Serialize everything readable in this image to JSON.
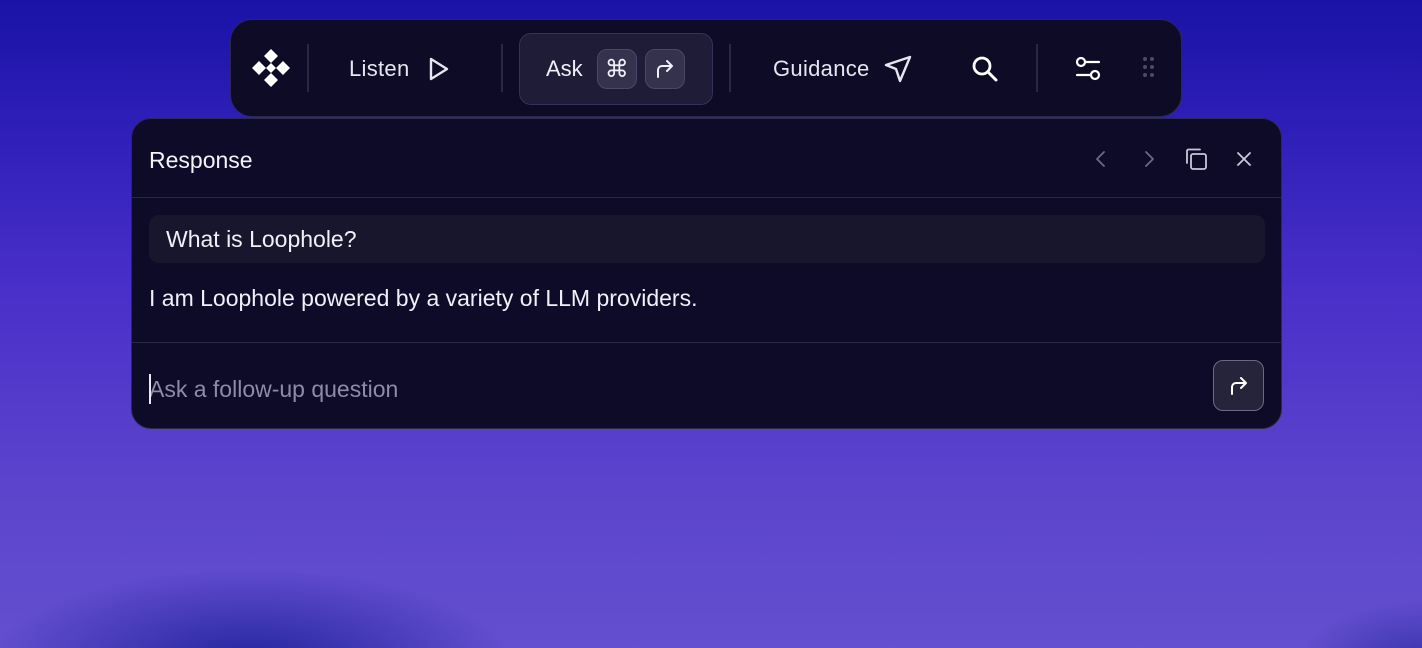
{
  "toolbar": {
    "logo_icon": "diamond-cluster-logo",
    "listen_label": "Listen",
    "listen_icon": "play-icon",
    "ask_label": "Ask",
    "ask_shortcut_keys": [
      "⌘",
      "↵"
    ],
    "guidance_label": "Guidance",
    "guidance_icon": "cursor-arrow-icon",
    "search_icon": "search-icon",
    "settings_icon": "sliders-icon",
    "drag_icon": "grip-icon"
  },
  "panel": {
    "title": "Response",
    "header_icons": [
      "chevron-left-icon",
      "chevron-right-icon",
      "copy-icon",
      "close-icon"
    ],
    "question": "What is Loophole?",
    "answer": "I am Loophole powered by a variety of LLM providers.",
    "followup_placeholder": "Ask a follow-up question",
    "followup_value": "",
    "send_icon": "send-arrow-icon"
  },
  "colors": {
    "background_top": "#1a12a6",
    "background_bottom": "#634fcf",
    "panel_bg": "#0e0b28",
    "text": "#f0f0f8"
  }
}
